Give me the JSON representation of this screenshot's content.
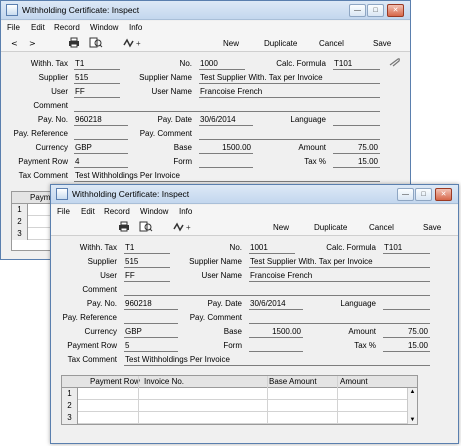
{
  "window_back": {
    "title": "Withholding Certificate: Inspect",
    "menus": [
      "File",
      "Edit",
      "Record",
      "Window",
      "Info"
    ],
    "toolbar": {
      "prev": "<",
      "next": ">",
      "new": "New",
      "duplicate": "Duplicate",
      "cancel": "Cancel",
      "save": "Save"
    },
    "fields": {
      "withh_tax_label": "Withh. Tax",
      "withh_tax": "T1",
      "no_label": "No.",
      "no": "1000",
      "calc_formula_label": "Calc. Formula",
      "calc_formula": "T101",
      "supplier_label": "Supplier",
      "supplier": "515",
      "supplier_name_label": "Supplier Name",
      "supplier_name": "Test Supplier With. Tax per Invoice",
      "user_label": "User",
      "user": "FF",
      "user_name_label": "User Name",
      "user_name": "Francoise French",
      "comment_label": "Comment",
      "comment": "",
      "pay_no_label": "Pay. No.",
      "pay_no": "960218",
      "pay_date_label": "Pay. Date",
      "pay_date": "30/6/2014",
      "language_label": "Language",
      "language": "",
      "pay_reference_label": "Pay. Reference",
      "pay_reference": "",
      "pay_comment_label": "Pay. Comment",
      "pay_comment": "",
      "currency_label": "Currency",
      "currency": "GBP",
      "base_label": "Base",
      "base": "1500.00",
      "amount_label": "Amount",
      "amount": "75.00",
      "payment_row_label": "Payment Row",
      "payment_row": "4",
      "form_label": "Form",
      "form": "",
      "tax_pct_label": "Tax %",
      "tax_pct": "15.00",
      "tax_comment_label": "Tax Comment",
      "tax_comment": "Test Withholdings Per Invoice"
    },
    "grid": {
      "col_payment": "Payme",
      "rows": [
        "1",
        "2",
        "3"
      ]
    }
  },
  "window_front": {
    "title": "Withholding Certificate: Inspect",
    "menus": [
      "File",
      "Edit",
      "Record",
      "Window",
      "Info"
    ],
    "toolbar": {
      "new": "New",
      "duplicate": "Duplicate",
      "cancel": "Cancel",
      "save": "Save"
    },
    "fields": {
      "withh_tax_label": "Withh. Tax",
      "withh_tax": "T1",
      "no_label": "No.",
      "no": "1001",
      "calc_formula_label": "Calc. Formula",
      "calc_formula": "T101",
      "supplier_label": "Supplier",
      "supplier": "515",
      "supplier_name_label": "Supplier Name",
      "supplier_name": "Test Supplier With. Tax per Invoice",
      "user_label": "User",
      "user": "FF",
      "user_name_label": "User Name",
      "user_name": "Francoise French",
      "comment_label": "Comment",
      "comment": "",
      "pay_no_label": "Pay. No.",
      "pay_no": "960218",
      "pay_date_label": "Pay. Date",
      "pay_date": "30/6/2014",
      "language_label": "Language",
      "language": "",
      "pay_reference_label": "Pay. Reference",
      "pay_reference": "",
      "pay_comment_label": "Pay. Comment",
      "pay_comment": "",
      "currency_label": "Currency",
      "currency": "GBP",
      "base_label": "Base",
      "base": "1500.00",
      "amount_label": "Amount",
      "amount": "75.00",
      "payment_row_label": "Payment Row",
      "payment_row": "5",
      "form_label": "Form",
      "form": "",
      "tax_pct_label": "Tax %",
      "tax_pct": "15.00",
      "tax_comment_label": "Tax Comment",
      "tax_comment": "Test Withholdings Per Invoice"
    },
    "grid": {
      "columns": [
        "Payment Row",
        "Invoice No.",
        "Base Amount",
        "Amount"
      ],
      "rows": [
        "1",
        "2",
        "3"
      ]
    }
  },
  "icons": [
    "window-app-icon",
    "minimize-icon",
    "maximize-icon",
    "close-icon",
    "print-icon",
    "print-preview-icon",
    "activity-icon",
    "paperclip-icon",
    "scroll-up-icon",
    "scroll-down-icon"
  ]
}
